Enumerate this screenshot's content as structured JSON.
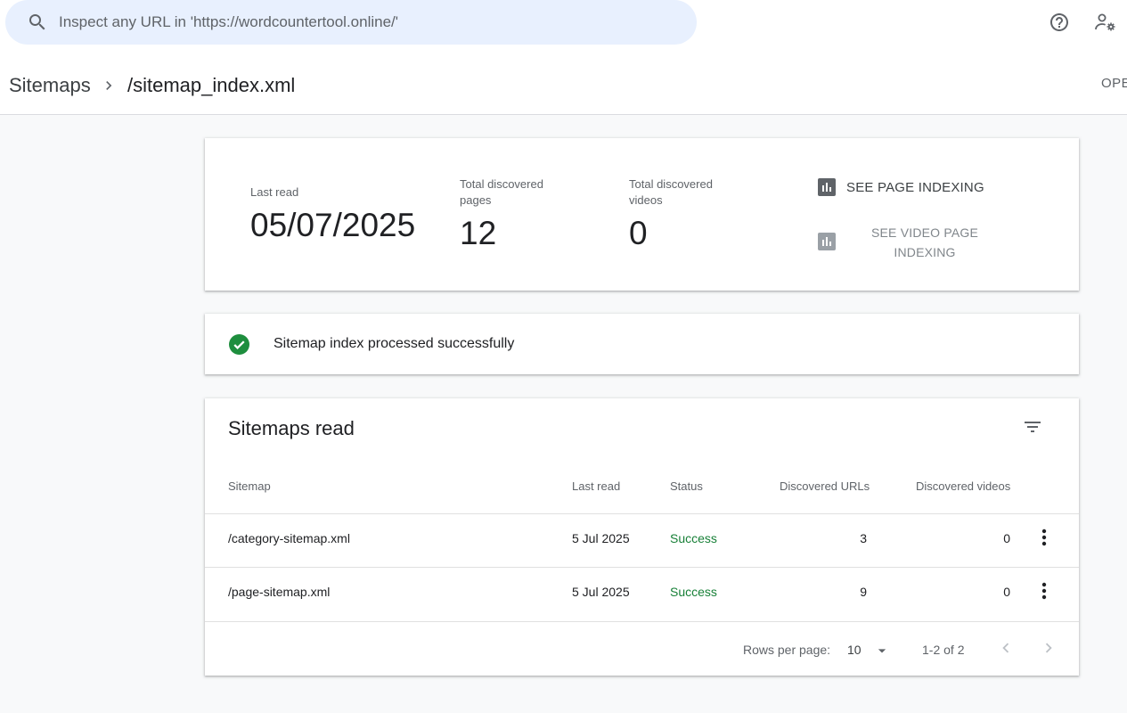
{
  "search": {
    "placeholder": "Inspect any URL in 'https://wordcountertool.online/'"
  },
  "header": {
    "breadcrumb_root": "Sitemaps",
    "breadcrumb_current": "/sitemap_index.xml",
    "open_link": "OPE"
  },
  "summary": {
    "last_read_label": "Last read",
    "last_read_value": "05/07/2025",
    "pages_label_1": "Total discovered",
    "pages_label_2": "pages",
    "pages_value": "12",
    "videos_label_1": "Total discovered",
    "videos_label_2": "videos",
    "videos_value": "0",
    "page_indexing_link": "SEE PAGE INDEXING",
    "video_indexing_link_1": "SEE VIDEO PAGE",
    "video_indexing_link_2": "INDEXING"
  },
  "status": {
    "message": "Sitemap index processed successfully"
  },
  "table": {
    "title": "Sitemaps read",
    "columns": {
      "sitemap": "Sitemap",
      "last_read": "Last read",
      "status": "Status",
      "discovered_urls": "Discovered URLs",
      "discovered_videos": "Discovered videos"
    },
    "rows": [
      {
        "sitemap": "/category-sitemap.xml",
        "last_read": "5 Jul 2025",
        "status": "Success",
        "urls": "3",
        "videos": "0"
      },
      {
        "sitemap": "/page-sitemap.xml",
        "last_read": "5 Jul 2025",
        "status": "Success",
        "urls": "9",
        "videos": "0"
      }
    ],
    "footer": {
      "rows_per_page_label": "Rows per page:",
      "rows_per_page_value": "10",
      "range": "1-2 of 2"
    }
  },
  "colors": {
    "search_bg": "#e8f0fe",
    "success_green": "#188038",
    "check_green": "#1e8e3e",
    "icon_grey": "#5f6368",
    "disabled_grey": "#9aa0a6"
  }
}
